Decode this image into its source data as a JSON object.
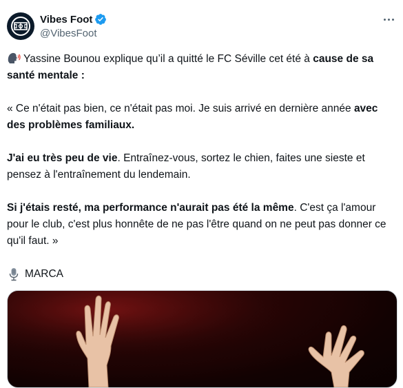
{
  "author": {
    "display_name": "Vibes Foot",
    "handle": "@VibesFoot"
  },
  "icons": {
    "avatar": "soccer-field-logo",
    "verified": "verified-badge-icon",
    "more": "more-options-icon",
    "speaking": "speaking-head-icon",
    "microphone": "microphone-icon"
  },
  "colors": {
    "verified": "#1d9bf0",
    "secondary_text": "#536471",
    "primary_text": "#0f1419"
  },
  "tweet": {
    "p1_a": " Yassine Bounou explique qu’il a quitté le FC Séville cet été à ",
    "p1_b": "cause de sa santé mentale",
    "p1_c": " :",
    "p2_a": "« Ce n'était pas bien, ce n'était pas moi. Je suis arrivé en dernière année ",
    "p2_b": "avec des problèmes familiaux",
    "p2_c": ".",
    "p3_a": "J'ai eu très peu de vie",
    "p3_b": ". Entraînez-vous, sortez le chien, faites une sieste et pensez à l'entraînement du lendemain.",
    "p4_a": "Si j'étais resté, ma performance n'aurait pas été la même",
    "p4_b": ". C'est ça l'amour pour le club, c'est plus honnête de ne pas l'être quand on ne peut pas donner ce qu'il faut. »",
    "source": "MARCA"
  }
}
